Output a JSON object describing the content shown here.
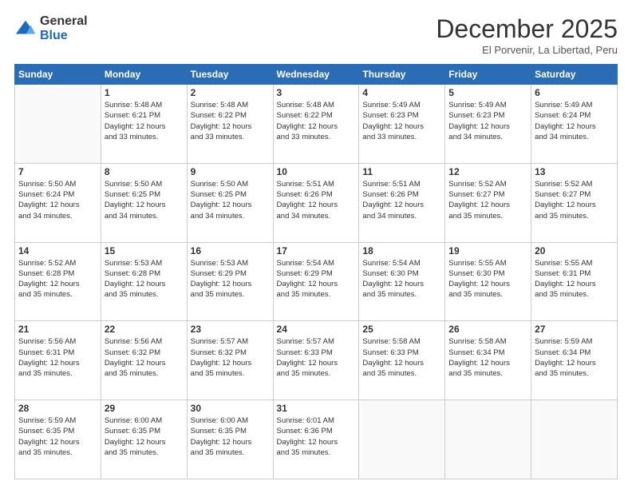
{
  "logo": {
    "general": "General",
    "blue": "Blue"
  },
  "header": {
    "title": "December 2025",
    "subtitle": "El Porvenir, La Libertad, Peru"
  },
  "days_of_week": [
    "Sunday",
    "Monday",
    "Tuesday",
    "Wednesday",
    "Thursday",
    "Friday",
    "Saturday"
  ],
  "weeks": [
    [
      {
        "day": "",
        "info": ""
      },
      {
        "day": "1",
        "info": "Sunrise: 5:48 AM\nSunset: 6:21 PM\nDaylight: 12 hours\nand 33 minutes."
      },
      {
        "day": "2",
        "info": "Sunrise: 5:48 AM\nSunset: 6:22 PM\nDaylight: 12 hours\nand 33 minutes."
      },
      {
        "day": "3",
        "info": "Sunrise: 5:48 AM\nSunset: 6:22 PM\nDaylight: 12 hours\nand 33 minutes."
      },
      {
        "day": "4",
        "info": "Sunrise: 5:49 AM\nSunset: 6:23 PM\nDaylight: 12 hours\nand 33 minutes."
      },
      {
        "day": "5",
        "info": "Sunrise: 5:49 AM\nSunset: 6:23 PM\nDaylight: 12 hours\nand 34 minutes."
      },
      {
        "day": "6",
        "info": "Sunrise: 5:49 AM\nSunset: 6:24 PM\nDaylight: 12 hours\nand 34 minutes."
      }
    ],
    [
      {
        "day": "7",
        "info": "Sunrise: 5:50 AM\nSunset: 6:24 PM\nDaylight: 12 hours\nand 34 minutes."
      },
      {
        "day": "8",
        "info": "Sunrise: 5:50 AM\nSunset: 6:25 PM\nDaylight: 12 hours\nand 34 minutes."
      },
      {
        "day": "9",
        "info": "Sunrise: 5:50 AM\nSunset: 6:25 PM\nDaylight: 12 hours\nand 34 minutes."
      },
      {
        "day": "10",
        "info": "Sunrise: 5:51 AM\nSunset: 6:26 PM\nDaylight: 12 hours\nand 34 minutes."
      },
      {
        "day": "11",
        "info": "Sunrise: 5:51 AM\nSunset: 6:26 PM\nDaylight: 12 hours\nand 34 minutes."
      },
      {
        "day": "12",
        "info": "Sunrise: 5:52 AM\nSunset: 6:27 PM\nDaylight: 12 hours\nand 35 minutes."
      },
      {
        "day": "13",
        "info": "Sunrise: 5:52 AM\nSunset: 6:27 PM\nDaylight: 12 hours\nand 35 minutes."
      }
    ],
    [
      {
        "day": "14",
        "info": "Sunrise: 5:52 AM\nSunset: 6:28 PM\nDaylight: 12 hours\nand 35 minutes."
      },
      {
        "day": "15",
        "info": "Sunrise: 5:53 AM\nSunset: 6:28 PM\nDaylight: 12 hours\nand 35 minutes."
      },
      {
        "day": "16",
        "info": "Sunrise: 5:53 AM\nSunset: 6:29 PM\nDaylight: 12 hours\nand 35 minutes."
      },
      {
        "day": "17",
        "info": "Sunrise: 5:54 AM\nSunset: 6:29 PM\nDaylight: 12 hours\nand 35 minutes."
      },
      {
        "day": "18",
        "info": "Sunrise: 5:54 AM\nSunset: 6:30 PM\nDaylight: 12 hours\nand 35 minutes."
      },
      {
        "day": "19",
        "info": "Sunrise: 5:55 AM\nSunset: 6:30 PM\nDaylight: 12 hours\nand 35 minutes."
      },
      {
        "day": "20",
        "info": "Sunrise: 5:55 AM\nSunset: 6:31 PM\nDaylight: 12 hours\nand 35 minutes."
      }
    ],
    [
      {
        "day": "21",
        "info": "Sunrise: 5:56 AM\nSunset: 6:31 PM\nDaylight: 12 hours\nand 35 minutes."
      },
      {
        "day": "22",
        "info": "Sunrise: 5:56 AM\nSunset: 6:32 PM\nDaylight: 12 hours\nand 35 minutes."
      },
      {
        "day": "23",
        "info": "Sunrise: 5:57 AM\nSunset: 6:32 PM\nDaylight: 12 hours\nand 35 minutes."
      },
      {
        "day": "24",
        "info": "Sunrise: 5:57 AM\nSunset: 6:33 PM\nDaylight: 12 hours\nand 35 minutes."
      },
      {
        "day": "25",
        "info": "Sunrise: 5:58 AM\nSunset: 6:33 PM\nDaylight: 12 hours\nand 35 minutes."
      },
      {
        "day": "26",
        "info": "Sunrise: 5:58 AM\nSunset: 6:34 PM\nDaylight: 12 hours\nand 35 minutes."
      },
      {
        "day": "27",
        "info": "Sunrise: 5:59 AM\nSunset: 6:34 PM\nDaylight: 12 hours\nand 35 minutes."
      }
    ],
    [
      {
        "day": "28",
        "info": "Sunrise: 5:59 AM\nSunset: 6:35 PM\nDaylight: 12 hours\nand 35 minutes."
      },
      {
        "day": "29",
        "info": "Sunrise: 6:00 AM\nSunset: 6:35 PM\nDaylight: 12 hours\nand 35 minutes."
      },
      {
        "day": "30",
        "info": "Sunrise: 6:00 AM\nSunset: 6:35 PM\nDaylight: 12 hours\nand 35 minutes."
      },
      {
        "day": "31",
        "info": "Sunrise: 6:01 AM\nSunset: 6:36 PM\nDaylight: 12 hours\nand 35 minutes."
      },
      {
        "day": "",
        "info": ""
      },
      {
        "day": "",
        "info": ""
      },
      {
        "day": "",
        "info": ""
      }
    ]
  ]
}
